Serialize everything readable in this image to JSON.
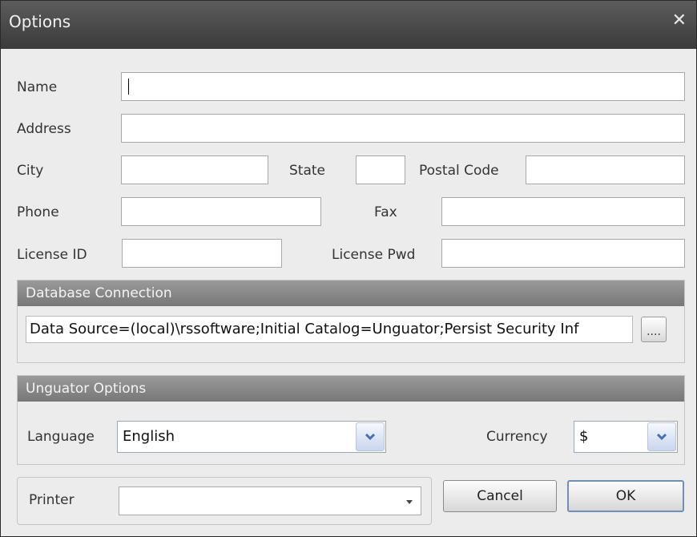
{
  "window": {
    "title": "Options"
  },
  "form": {
    "name_label": "Name",
    "name_value": "",
    "address_label": "Address",
    "address_value": "",
    "city_label": "City",
    "city_value": "",
    "state_label": "State",
    "state_value": "",
    "postal_label": "Postal Code",
    "postal_value": "",
    "phone_label": "Phone",
    "phone_value": "",
    "fax_label": "Fax",
    "fax_value": "",
    "license_id_label": "License ID",
    "license_id_value": "",
    "license_pwd_label": "License Pwd",
    "license_pwd_value": ""
  },
  "database": {
    "header": "Database Connection",
    "connection_string": "Data Source=(local)\\rssoftware;Initial Catalog=Unguator;Persist Security Inf",
    "browse_label": "...."
  },
  "options": {
    "header": "Unguator Options",
    "language_label": "Language",
    "language_value": "English",
    "currency_label": "Currency",
    "currency_value": "$"
  },
  "printer": {
    "label": "Printer",
    "value": ""
  },
  "buttons": {
    "cancel": "Cancel",
    "ok": "OK"
  },
  "icons": {
    "close": "close-icon",
    "dropdown": "chevron-down-icon"
  },
  "colors": {
    "title_bar": "#4a4a4a",
    "group_header": "#888888",
    "dropdown_accent": "#4a6fb0"
  }
}
